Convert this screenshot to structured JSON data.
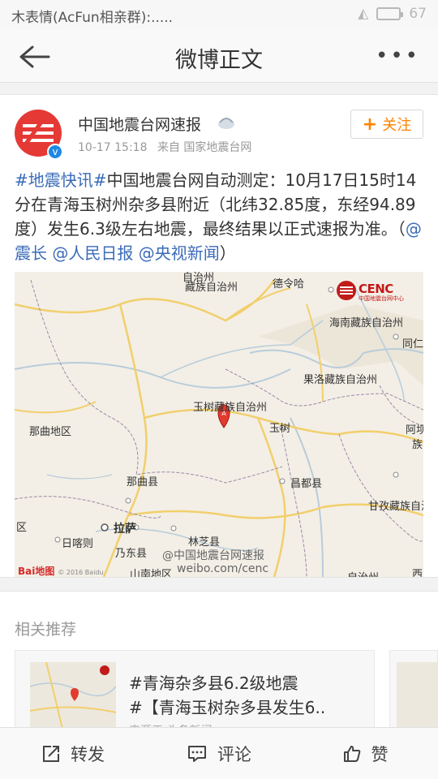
{
  "status": {
    "left": "木表情(AcFun相亲群):.....",
    "battery": "67"
  },
  "nav": {
    "title": "微博正文",
    "more": "•••"
  },
  "post": {
    "author": "中国地震台网速报",
    "time": "10-17 15:18",
    "source": "来自 国家地震台网",
    "follow": "关注",
    "follow_plus": "+",
    "verified": "v",
    "tag": "#地震快讯#",
    "text1": "中国地震台网自动测定：10月17日15时14分在青海玉树州杂多县附近（北纬32.85度，东经94.89度）发生6.3级左右地震，最终结果以正式速报为准。（",
    "mention1": "@震长",
    "mention2": "@人民日报",
    "mention3": "@央视新闻",
    "close": "）"
  },
  "map": {
    "labels": {
      "tibet_north": "藏族自治州",
      "delingha": "德令哈",
      "hainan": "海南藏族自治州",
      "tongren": "同仁",
      "guoluo": "果洛藏族自治州",
      "yushu_pref": "玉树藏族自治州",
      "yushu": "玉树",
      "naqu_region": "那曲地区",
      "naqu": "那曲县",
      "aba": "阿坝",
      "aba2": "族",
      "changdu": "昌都县",
      "ganzi": "甘孜藏族自治",
      "lasa": "拉萨",
      "rikaze": "日喀则",
      "qu": "区",
      "linzhi": "林芝县",
      "naidong": "乃东县",
      "shannan": "山南地区",
      "xi": "西",
      "zhouzhou": "自治州",
      "top_left": "自治州",
      "marker": "A"
    },
    "logo": {
      "name": "CENC",
      "sub": "中国地震台网中心"
    },
    "watermark1": "@中国地震台网速报",
    "watermark2": "weibo.com/cenc",
    "baidu": "Bai地图",
    "copyright": "© 2016 Baidu"
  },
  "related": {
    "header": "相关推荐",
    "card1": {
      "line1": "#青海杂多县6.2级地震",
      "line2": "#【青海玉树杂多县发生6..",
      "line3": "来源于 头条新闻"
    }
  },
  "toolbar": {
    "repost": "转发",
    "comment": "评论",
    "like": "赞"
  },
  "colors": {
    "accent": "#ff8200",
    "link": "#3a6bb8",
    "cenc_red": "#c21a1a"
  },
  "icons": [
    "back-arrow-icon",
    "more-icon",
    "crown-icon",
    "verified-icon",
    "repost-icon",
    "comment-icon",
    "like-icon",
    "map-marker-icon"
  ]
}
